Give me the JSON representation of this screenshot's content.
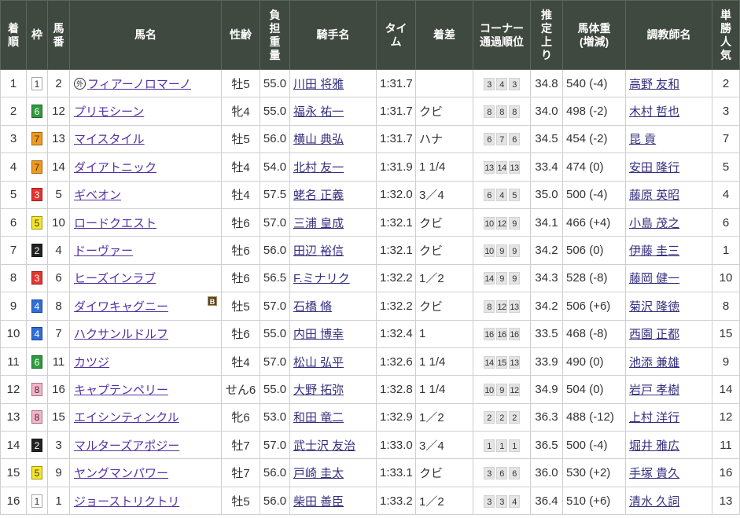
{
  "colors": {
    "header_bg": "#404940",
    "horse_link": "#5430a6",
    "person_link": "#35307f"
  },
  "header": {
    "rank": "着\n順",
    "waku": "枠",
    "umaban": "馬\n番",
    "name": "馬名",
    "sex_age": "性齢",
    "weight_carried": "負\n担\n重\n量",
    "jockey": "騎手名",
    "time": "タイ\nム",
    "margin": "着差",
    "corners": "コーナー\n通過順位",
    "last3f": "推\n定\n上\nり",
    "body_weight": "馬体重\n(増減)",
    "trainer": "調教師名",
    "popularity": "単\n勝\n人\n気"
  },
  "waku_colors": {
    "1": {
      "bg": "#ffffff",
      "fg": "#333333"
    },
    "2": {
      "bg": "#222222",
      "fg": "#ffffff"
    },
    "3": {
      "bg": "#e5352f",
      "fg": "#ffffff"
    },
    "4": {
      "bg": "#2e6fd8",
      "fg": "#ffffff"
    },
    "5": {
      "bg": "#f6e62a",
      "fg": "#333333"
    },
    "6": {
      "bg": "#2f9b3c",
      "fg": "#ffffff"
    },
    "7": {
      "bg": "#f39a1b",
      "fg": "#333333"
    },
    "8": {
      "bg": "#f7b3c9",
      "fg": "#333333"
    }
  },
  "rows": [
    {
      "rank": "1",
      "waku": "1",
      "umaban": "2",
      "marker": "外",
      "name": "フィアーノロマーノ",
      "sex_age": "牡5",
      "weight_carried": "55.0",
      "jockey": "川田 将雅",
      "time": "1:31.7",
      "corners": [
        "3",
        "4",
        "3"
      ],
      "last3f": "34.8",
      "body_weight": "540 (-4)",
      "trainer": "高野 友和",
      "popularity": "2"
    },
    {
      "rank": "2",
      "waku": "6",
      "umaban": "12",
      "name": "プリモシーン",
      "sex_age": "牝4",
      "weight_carried": "55.0",
      "jockey": "福永 祐一",
      "time": "1:31.7",
      "margin": "クビ",
      "corners": [
        "8",
        "8",
        "8"
      ],
      "last3f": "34.0",
      "body_weight": "498 (-2)",
      "trainer": "木村 哲也",
      "popularity": "3"
    },
    {
      "rank": "3",
      "waku": "7",
      "umaban": "13",
      "name": "マイスタイル",
      "sex_age": "牡5",
      "weight_carried": "56.0",
      "jockey": "横山 典弘",
      "time": "1:31.7",
      "margin": "ハナ",
      "corners": [
        "6",
        "7",
        "6"
      ],
      "last3f": "34.5",
      "body_weight": "454 (-2)",
      "trainer": "昆 貢",
      "popularity": "7"
    },
    {
      "rank": "4",
      "waku": "7",
      "umaban": "14",
      "name": "ダイアトニック",
      "sex_age": "牡4",
      "weight_carried": "54.0",
      "jockey": "北村 友一",
      "time": "1:31.9",
      "margin": "1 1/4",
      "corners": [
        "13",
        "14",
        "13"
      ],
      "last3f": "33.4",
      "body_weight": "474 (0)",
      "trainer": "安田 隆行",
      "popularity": "5"
    },
    {
      "rank": "5",
      "waku": "3",
      "umaban": "5",
      "name": "ギベオン",
      "sex_age": "牡4",
      "weight_carried": "57.5",
      "jockey": "蛯名 正義",
      "time": "1:32.0",
      "margin": "3／4",
      "corners": [
        "6",
        "4",
        "5"
      ],
      "last3f": "35.0",
      "body_weight": "500 (-4)",
      "trainer": "藤原 英昭",
      "popularity": "4"
    },
    {
      "rank": "6",
      "waku": "5",
      "umaban": "10",
      "name": "ロードクエスト",
      "sex_age": "牡6",
      "weight_carried": "57.0",
      "jockey": "三浦 皇成",
      "time": "1:32.1",
      "margin": "クビ",
      "corners": [
        "10",
        "12",
        "9"
      ],
      "last3f": "34.1",
      "body_weight": "466 (+4)",
      "trainer": "小島 茂之",
      "popularity": "6"
    },
    {
      "rank": "7",
      "waku": "2",
      "umaban": "4",
      "name": "ドーヴァー",
      "sex_age": "牡6",
      "weight_carried": "56.0",
      "jockey": "田辺 裕信",
      "time": "1:32.1",
      "margin": "クビ",
      "corners": [
        "10",
        "9",
        "9"
      ],
      "last3f": "34.2",
      "body_weight": "506 (0)",
      "trainer": "伊藤 圭三",
      "popularity": "1"
    },
    {
      "rank": "8",
      "waku": "3",
      "umaban": "6",
      "name": "ヒーズインラブ",
      "sex_age": "牡6",
      "weight_carried": "56.5",
      "jockey": "F.ミナリク",
      "time": "1:32.2",
      "margin": "1／2",
      "corners": [
        "14",
        "9",
        "9"
      ],
      "last3f": "34.3",
      "body_weight": "528 (-8)",
      "trainer": "藤岡 健一",
      "popularity": "10"
    },
    {
      "rank": "9",
      "waku": "4",
      "umaban": "8",
      "name": "ダイワキャグニー",
      "blinker": "B",
      "sex_age": "牡5",
      "weight_carried": "57.0",
      "jockey": "石橋 脩",
      "time": "1:32.2",
      "margin": "クビ",
      "corners": [
        "8",
        "12",
        "13"
      ],
      "last3f": "34.2",
      "body_weight": "506 (+6)",
      "trainer": "菊沢 隆徳",
      "popularity": "8"
    },
    {
      "rank": "10",
      "waku": "4",
      "umaban": "7",
      "name": "ハクサンルドルフ",
      "sex_age": "牡6",
      "weight_carried": "55.0",
      "jockey": "内田 博幸",
      "time": "1:32.4",
      "margin": "1",
      "corners": [
        "16",
        "16",
        "16"
      ],
      "last3f": "33.5",
      "body_weight": "468 (-8)",
      "trainer": "西園 正都",
      "popularity": "15"
    },
    {
      "rank": "11",
      "waku": "6",
      "umaban": "11",
      "name": "カツジ",
      "sex_age": "牡4",
      "weight_carried": "57.0",
      "jockey": "松山 弘平",
      "time": "1:32.6",
      "margin": "1 1/4",
      "corners": [
        "14",
        "15",
        "13"
      ],
      "last3f": "33.9",
      "body_weight": "490 (0)",
      "trainer": "池添 兼雄",
      "popularity": "9"
    },
    {
      "rank": "12",
      "waku": "8",
      "umaban": "16",
      "name": "キャプテンペリー",
      "sex_age": "せん6",
      "weight_carried": "55.0",
      "jockey": "大野 拓弥",
      "time": "1:32.8",
      "margin": "1 1/4",
      "corners": [
        "10",
        "9",
        "12"
      ],
      "last3f": "34.9",
      "body_weight": "504 (0)",
      "trainer": "岩戸 孝樹",
      "popularity": "14"
    },
    {
      "rank": "13",
      "waku": "8",
      "umaban": "15",
      "name": "エイシンティンクル",
      "sex_age": "牝6",
      "weight_carried": "53.0",
      "jockey": "和田 竜二",
      "time": "1:32.9",
      "margin": "1／2",
      "corners": [
        "2",
        "2",
        "2"
      ],
      "last3f": "36.3",
      "body_weight": "488 (-12)",
      "trainer": "上村 洋行",
      "popularity": "12"
    },
    {
      "rank": "14",
      "waku": "2",
      "umaban": "3",
      "name": "マルターズアポジー",
      "sex_age": "牡7",
      "weight_carried": "57.0",
      "jockey": "武士沢 友治",
      "time": "1:33.0",
      "margin": "3／4",
      "corners": [
        "1",
        "1",
        "1"
      ],
      "last3f": "36.5",
      "body_weight": "500 (-4)",
      "trainer": "堀井 雅広",
      "popularity": "11"
    },
    {
      "rank": "15",
      "waku": "5",
      "umaban": "9",
      "name": "ヤングマンパワー",
      "sex_age": "牡7",
      "weight_carried": "56.0",
      "jockey": "戸崎 圭太",
      "time": "1:33.1",
      "margin": "クビ",
      "corners": [
        "3",
        "6",
        "6"
      ],
      "last3f": "36.0",
      "body_weight": "530 (+2)",
      "trainer": "手塚 貴久",
      "popularity": "16"
    },
    {
      "rank": "16",
      "waku": "1",
      "umaban": "1",
      "name": "ジョーストリクトリ",
      "sex_age": "牡5",
      "weight_carried": "56.0",
      "jockey": "柴田 善臣",
      "time": "1:33.2",
      "margin": "1／2",
      "corners": [
        "3",
        "3",
        "4"
      ],
      "last3f": "36.4",
      "body_weight": "510 (+6)",
      "trainer": "清水 久詞",
      "popularity": "13"
    }
  ]
}
